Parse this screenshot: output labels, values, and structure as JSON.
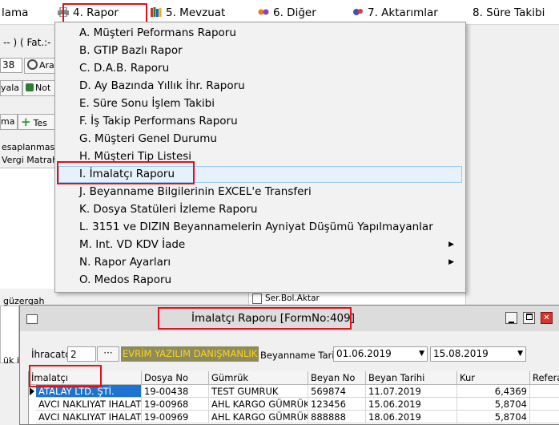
{
  "menubar": {
    "items": [
      {
        "label": "lama"
      },
      {
        "label": "4.  Rapor"
      },
      {
        "label": "5.  Mevzuat"
      },
      {
        "label": "6.  Diğer"
      },
      {
        "label": "7.  Aktarımlar"
      },
      {
        "label": "8. Süre Takibi"
      }
    ]
  },
  "background": {
    "fat_label": "-- ) ( Fat.:-",
    "field_value": "38",
    "search_button": "Ara",
    "tab_1": "yala",
    "tab_2": "Not",
    "tab_3": "ma",
    "tab_4": "Tes",
    "text_1": "esaplanması",
    "text_2": "Vergi Matrahı",
    "text_3": "güzergah",
    "text_4": "ük id",
    "ser_bol": "Ser.Bol.Aktar"
  },
  "dropdown": {
    "items": [
      {
        "label": "A.  Müşteri Peformans Raporu"
      },
      {
        "label": "B.  GTIP Bazlı Rapor"
      },
      {
        "label": "C.  D.A.B. Raporu"
      },
      {
        "label": "D.  Ay Bazında Yıllık İhr. Raporu"
      },
      {
        "label": "E.  Süre Sonu İşlem Takibi"
      },
      {
        "label": "F.  İş Takip Performans Raporu"
      },
      {
        "label": "G.  Müşteri Genel Durumu"
      },
      {
        "label": "H.  Müşteri Tip Listesi"
      },
      {
        "label": "I.  İmalatçı Raporu"
      },
      {
        "label": "J.  Beyanname Bilgilerinin EXCEL'e Transferi"
      },
      {
        "label": "K.  Dosya Statüleri İzleme Raporu"
      },
      {
        "label": "L.  3151 ve DIZIN Beyannamelerin Ayniyat Düşümü Yapılmayanlar"
      },
      {
        "label": "M. Int. VD KDV İade"
      },
      {
        "label": "N.  Rapor Ayarları"
      },
      {
        "label": "O. Medos Raporu"
      }
    ]
  },
  "form": {
    "title": "İmalatçı Raporu [FormNo:409]",
    "ihracatci_label": "İhracatçı",
    "ihracatci_code": "2",
    "ellipsis": "···",
    "company": "EVRİM YAZILIM DANIŞMANLIK A.Ş",
    "beyanname_label": "Beyanname Tarihi",
    "date_from": "01.06.2019",
    "date_to": "15.08.2019",
    "columns": [
      "İmalatçı",
      "Dosya No",
      "Gümrük",
      "Beyan No",
      "Beyan Tarihi",
      "Kur",
      "Referar"
    ],
    "rows": [
      [
        "ATALAY LTD. ŞTİ.",
        "19-00438",
        "TEST GUMRUK",
        "569874",
        "11.07.2019",
        "6,4369",
        ""
      ],
      [
        "AVCI NAKLIYAT IHALAT",
        "19-00968",
        "AHL KARGO GÜMRÜK M",
        "123456",
        "15.06.2019",
        "5,8704",
        ""
      ],
      [
        "AVCI NAKLIYAT IHALAT",
        "19-00969",
        "AHL KARGO GÜMRÜK M",
        "888888",
        "18.06.2019",
        "5,8704",
        ""
      ]
    ]
  },
  "colors": {
    "highlight": "#e5f1fb",
    "selection": "#1c74d0",
    "annotation_red": "#e0101a",
    "company_bg": "#8c8c5a",
    "company_fg": "#ffd21e"
  }
}
